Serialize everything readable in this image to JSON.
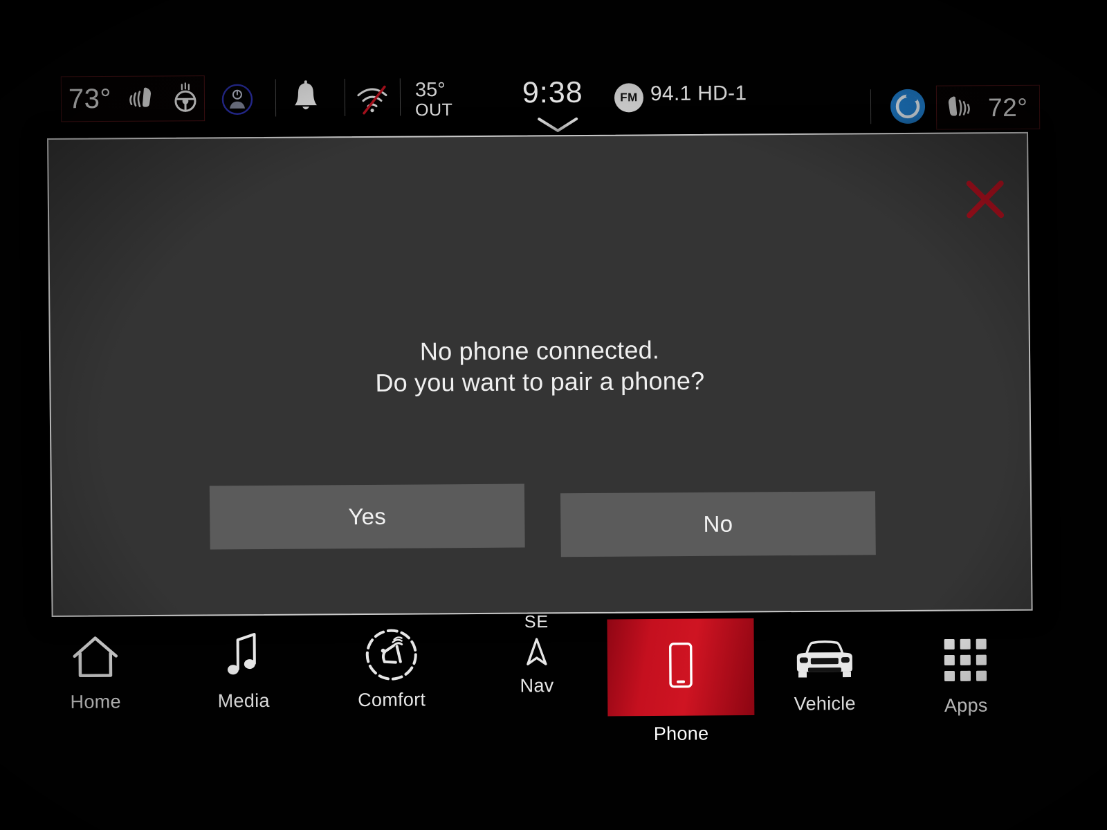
{
  "status_bar": {
    "driver_zone": {
      "temperature": "73°",
      "seat_heat_icon": "heated-seat-icon",
      "steering_wheel_heat_icon": "heated-steering-wheel-icon"
    },
    "driver_profile_icon": "driver-profile-icon",
    "notification_icon": "bell-icon",
    "wifi_icon": "wifi-off-icon",
    "outside_temp": {
      "value": "35°",
      "label": "OUT"
    },
    "clock": "9:38",
    "clock_chevron_icon": "chevron-down-icon",
    "radio": {
      "band": "FM",
      "station": "94.1 HD-1"
    },
    "assistant_icon": "assistant-circle-icon",
    "passenger_zone": {
      "temperature": "72°",
      "seat_heat_icon": "heated-seat-icon"
    }
  },
  "dialog": {
    "close_icon": "close-x-icon",
    "message_line_1": "No phone connected.",
    "message_line_2": "Do you want to pair a phone?",
    "yes_label": "Yes",
    "no_label": "No"
  },
  "nav_bar": {
    "items": [
      {
        "id": "home",
        "label": "Home",
        "icon": "home-icon",
        "active": false
      },
      {
        "id": "media",
        "label": "Media",
        "icon": "music-note-icon",
        "active": false
      },
      {
        "id": "comfort",
        "label": "Comfort",
        "icon": "comfort-seat-icon",
        "active": false
      },
      {
        "id": "nav",
        "label": "Nav",
        "icon": "compass-arrow-icon",
        "heading": "SE",
        "active": false
      },
      {
        "id": "phone",
        "label": "Phone",
        "icon": "phone-icon",
        "active": true
      },
      {
        "id": "vehicle",
        "label": "Vehicle",
        "icon": "vehicle-front-icon",
        "active": false
      },
      {
        "id": "apps",
        "label": "Apps",
        "icon": "grid-apps-icon",
        "active": false
      }
    ]
  },
  "colors": {
    "accent_red": "#c5101f",
    "close_red": "#9e0f1c",
    "panel_gray": "#343434",
    "button_gray": "#5b5b5b",
    "text_white": "#f0f0f0"
  }
}
